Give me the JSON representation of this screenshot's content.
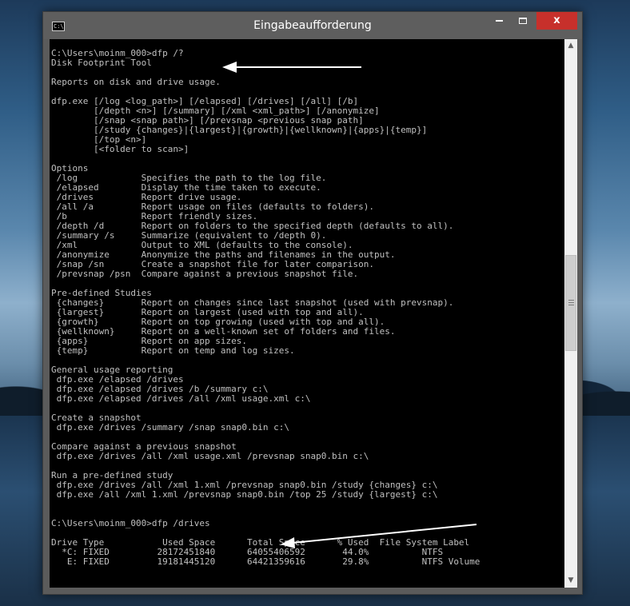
{
  "window": {
    "title": "Eingabeaufforderung",
    "close_label": "x",
    "icon_text": "C:\\"
  },
  "console": {
    "lines": [
      "C:\\Users\\moinm_000>dfp /?",
      "Disk Footprint Tool",
      "",
      "Reports on disk and drive usage.",
      "",
      "dfp.exe [/log <log_path>] [/elapsed] [/drives] [/all] [/b]",
      "        [/depth <n>] [/summary] [/xml <xml_path>] [/anonymize]",
      "        [/snap <snap path>] [/prevsnap <previous snap path]",
      "        [/study {changes}|{largest}|{growth}|{wellknown}|{apps}|{temp}]",
      "        [/top <n>]",
      "        [<folder to scan>]",
      "",
      "Options",
      " /log            Specifies the path to the log file.",
      " /elapsed        Display the time taken to execute.",
      " /drives         Report drive usage.",
      " /all /a         Report usage on files (defaults to folders).",
      " /b              Report friendly sizes.",
      " /depth /d       Report on folders to the specified depth (defaults to all).",
      " /summary /s     Summarize (equivalent to /depth 0).",
      " /xml            Output to XML (defaults to the console).",
      " /anonymize      Anonymize the paths and filenames in the output.",
      " /snap /sn       Create a snapshot file for later comparison.",
      " /prevsnap /psn  Compare against a previous snapshot file.",
      "",
      "Pre-defined Studies",
      " {changes}       Report on changes since last snapshot (used with prevsnap).",
      " {largest}       Report on largest (used with top and all).",
      " {growth}        Report on top growing (used with top and all).",
      " {wellknown}     Report on a well-known set of folders and files.",
      " {apps}          Report on app sizes.",
      " {temp}          Report on temp and log sizes.",
      "",
      "General usage reporting",
      " dfp.exe /elapsed /drives",
      " dfp.exe /elapsed /drives /b /summary c:\\",
      " dfp.exe /elapsed /drives /all /xml usage.xml c:\\",
      "",
      "Create a snapshot",
      " dfp.exe /drives /summary /snap snap0.bin c:\\",
      "",
      "Compare against a previous snapshot",
      " dfp.exe /drives /all /xml usage.xml /prevsnap snap0.bin c:\\",
      "",
      "Run a pre-defined study",
      " dfp.exe /drives /all /xml 1.xml /prevsnap snap0.bin /study {changes} c:\\",
      " dfp.exe /all /xml 1.xml /prevsnap snap0.bin /top 25 /study {largest} c:\\",
      "",
      "",
      "C:\\Users\\moinm_000>dfp /drives",
      "",
      "Drive Type           Used Space      Total Space      % Used  File System Label",
      "  *C: FIXED         28172451840      64055406592       44.0%          NTFS",
      "   E: FIXED         19181445120      64421359616       29.8%          NTFS Volume"
    ]
  }
}
